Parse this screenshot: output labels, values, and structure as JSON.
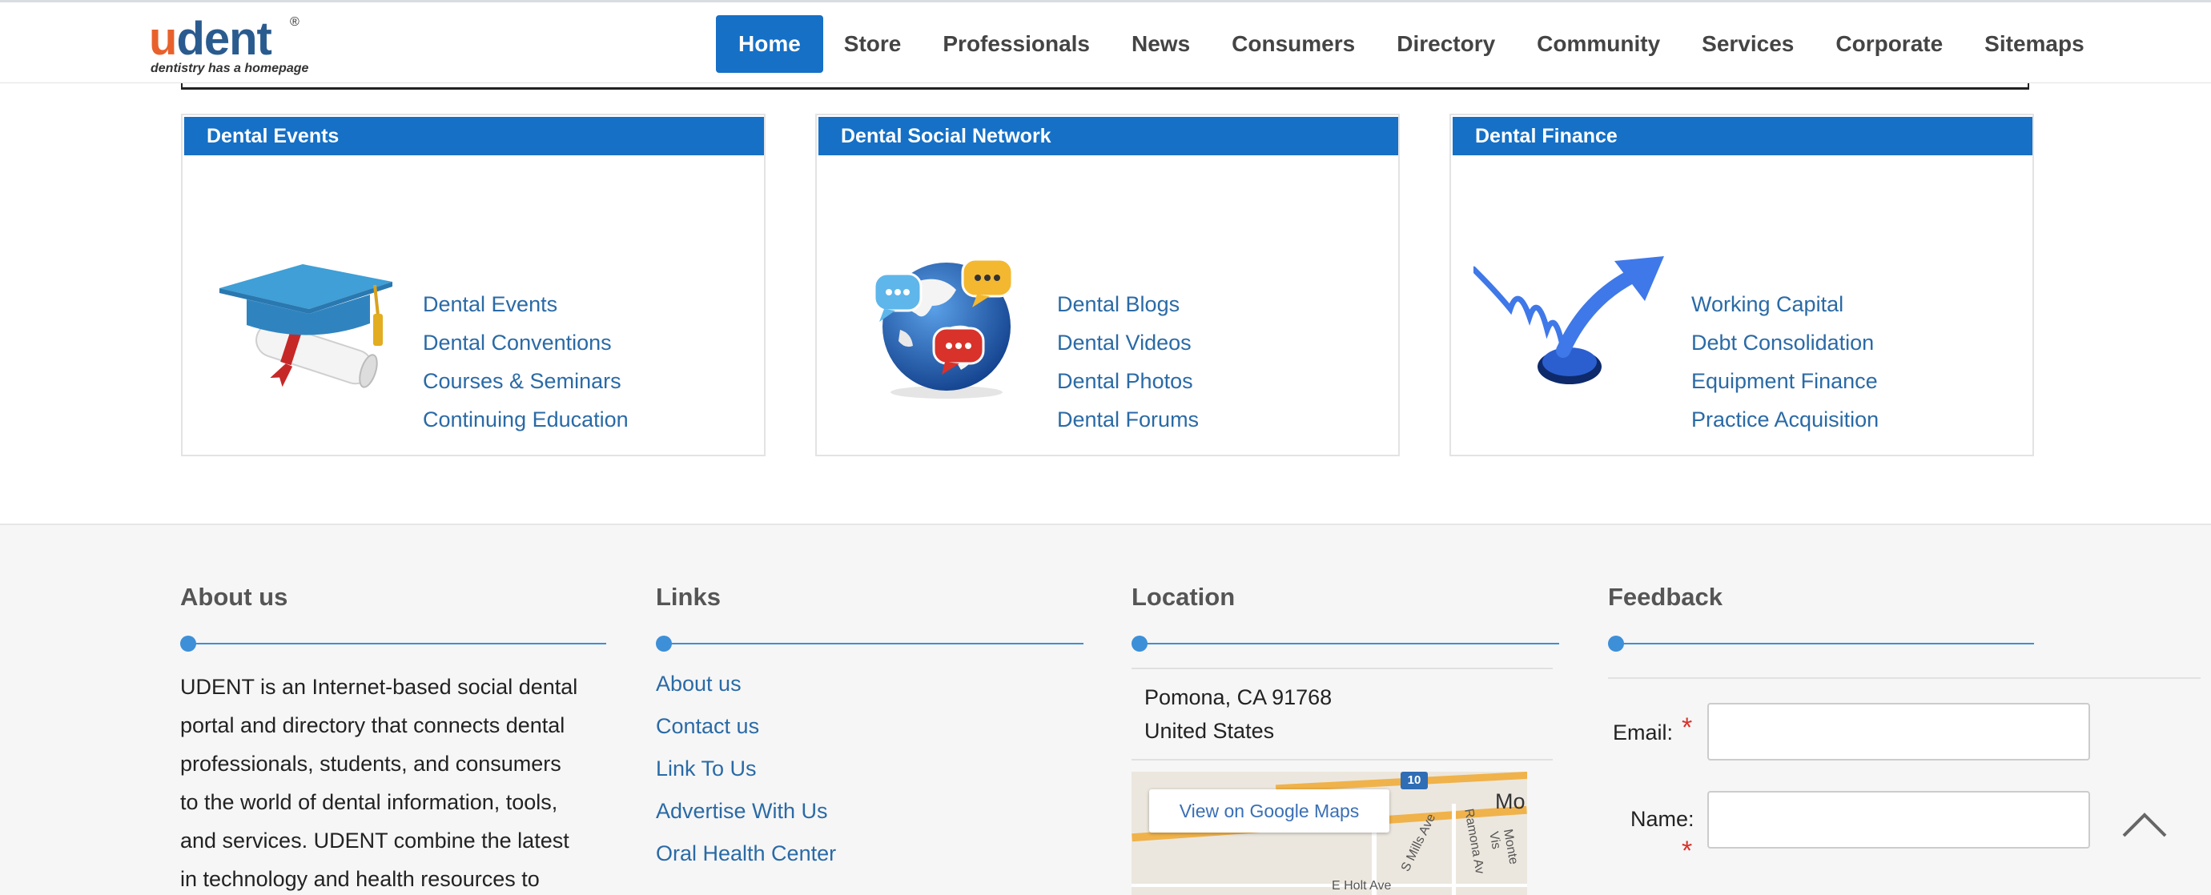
{
  "header": {
    "logo": {
      "u": "u",
      "dent": "dent",
      "reg": "®",
      "tagline": "dentistry has a homepage"
    },
    "nav": [
      {
        "label": "Home",
        "active": true
      },
      {
        "label": "Store"
      },
      {
        "label": "Professionals"
      },
      {
        "label": "News"
      },
      {
        "label": "Consumers"
      },
      {
        "label": "Directory"
      },
      {
        "label": "Community"
      },
      {
        "label": "Services"
      },
      {
        "label": "Corporate"
      },
      {
        "label": "Sitemaps"
      }
    ]
  },
  "panels": [
    {
      "title": "Dental Events",
      "icon": "graduation-cap-diploma-icon",
      "links": [
        "Dental Events",
        "Dental Conventions",
        "Courses & Seminars",
        "Continuing Education"
      ]
    },
    {
      "title": "Dental Social Network",
      "icon": "globe-chat-bubbles-icon",
      "links": [
        "Dental Blogs",
        "Dental Videos",
        "Dental Photos",
        "Dental Forums"
      ]
    },
    {
      "title": "Dental Finance",
      "icon": "rising-arrow-spring-icon",
      "links": [
        "Working Capital",
        "Debt Consolidation",
        "Equipment Finance",
        "Practice Acquisition"
      ]
    }
  ],
  "footer": {
    "about": {
      "title": "About us",
      "lines": [
        "UDENT is an Internet-based social dental",
        "portal and directory that connects dental",
        "professionals, students, and consumers",
        "to the world of dental information, tools,",
        "and services.  UDENT combine the latest",
        "in technology and health resources to"
      ]
    },
    "links": {
      "title": "Links",
      "items": [
        "About us",
        "Contact us",
        "Link To Us",
        "Advertise With Us",
        "Oral Health Center"
      ]
    },
    "location": {
      "title": "Location",
      "line1": "Pomona, CA 91768",
      "line2": "United States",
      "map_button": "View on Google Maps",
      "map_highway": "10",
      "map_town": "Mo",
      "map_street1": "S Mills Ave",
      "map_street2": "Ramona Av",
      "map_street3": "Monte Vis",
      "map_street4": "E Holt Ave"
    },
    "feedback": {
      "title": "Feedback",
      "email_label": "Email:",
      "name_label": "Name:",
      "required_mark": "*"
    }
  },
  "colors": {
    "brand_blue": "#1570c6",
    "accent_orange": "#e8612c",
    "link": "#2a6aa6",
    "required": "#d8322b"
  }
}
